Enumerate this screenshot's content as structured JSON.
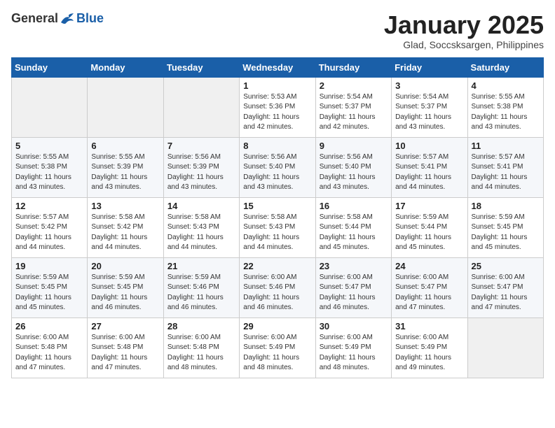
{
  "logo": {
    "general": "General",
    "blue": "Blue"
  },
  "title": "January 2025",
  "subtitle": "Glad, Soccsksargen, Philippines",
  "days_header": [
    "Sunday",
    "Monday",
    "Tuesday",
    "Wednesday",
    "Thursday",
    "Friday",
    "Saturday"
  ],
  "weeks": [
    [
      {
        "day": "",
        "info": ""
      },
      {
        "day": "",
        "info": ""
      },
      {
        "day": "",
        "info": ""
      },
      {
        "day": "1",
        "info": "Sunrise: 5:53 AM\nSunset: 5:36 PM\nDaylight: 11 hours and 42 minutes."
      },
      {
        "day": "2",
        "info": "Sunrise: 5:54 AM\nSunset: 5:37 PM\nDaylight: 11 hours and 42 minutes."
      },
      {
        "day": "3",
        "info": "Sunrise: 5:54 AM\nSunset: 5:37 PM\nDaylight: 11 hours and 43 minutes."
      },
      {
        "day": "4",
        "info": "Sunrise: 5:55 AM\nSunset: 5:38 PM\nDaylight: 11 hours and 43 minutes."
      }
    ],
    [
      {
        "day": "5",
        "info": "Sunrise: 5:55 AM\nSunset: 5:38 PM\nDaylight: 11 hours and 43 minutes."
      },
      {
        "day": "6",
        "info": "Sunrise: 5:55 AM\nSunset: 5:39 PM\nDaylight: 11 hours and 43 minutes."
      },
      {
        "day": "7",
        "info": "Sunrise: 5:56 AM\nSunset: 5:39 PM\nDaylight: 11 hours and 43 minutes."
      },
      {
        "day": "8",
        "info": "Sunrise: 5:56 AM\nSunset: 5:40 PM\nDaylight: 11 hours and 43 minutes."
      },
      {
        "day": "9",
        "info": "Sunrise: 5:56 AM\nSunset: 5:40 PM\nDaylight: 11 hours and 43 minutes."
      },
      {
        "day": "10",
        "info": "Sunrise: 5:57 AM\nSunset: 5:41 PM\nDaylight: 11 hours and 44 minutes."
      },
      {
        "day": "11",
        "info": "Sunrise: 5:57 AM\nSunset: 5:41 PM\nDaylight: 11 hours and 44 minutes."
      }
    ],
    [
      {
        "day": "12",
        "info": "Sunrise: 5:57 AM\nSunset: 5:42 PM\nDaylight: 11 hours and 44 minutes."
      },
      {
        "day": "13",
        "info": "Sunrise: 5:58 AM\nSunset: 5:42 PM\nDaylight: 11 hours and 44 minutes."
      },
      {
        "day": "14",
        "info": "Sunrise: 5:58 AM\nSunset: 5:43 PM\nDaylight: 11 hours and 44 minutes."
      },
      {
        "day": "15",
        "info": "Sunrise: 5:58 AM\nSunset: 5:43 PM\nDaylight: 11 hours and 44 minutes."
      },
      {
        "day": "16",
        "info": "Sunrise: 5:58 AM\nSunset: 5:44 PM\nDaylight: 11 hours and 45 minutes."
      },
      {
        "day": "17",
        "info": "Sunrise: 5:59 AM\nSunset: 5:44 PM\nDaylight: 11 hours and 45 minutes."
      },
      {
        "day": "18",
        "info": "Sunrise: 5:59 AM\nSunset: 5:45 PM\nDaylight: 11 hours and 45 minutes."
      }
    ],
    [
      {
        "day": "19",
        "info": "Sunrise: 5:59 AM\nSunset: 5:45 PM\nDaylight: 11 hours and 45 minutes."
      },
      {
        "day": "20",
        "info": "Sunrise: 5:59 AM\nSunset: 5:45 PM\nDaylight: 11 hours and 46 minutes."
      },
      {
        "day": "21",
        "info": "Sunrise: 5:59 AM\nSunset: 5:46 PM\nDaylight: 11 hours and 46 minutes."
      },
      {
        "day": "22",
        "info": "Sunrise: 6:00 AM\nSunset: 5:46 PM\nDaylight: 11 hours and 46 minutes."
      },
      {
        "day": "23",
        "info": "Sunrise: 6:00 AM\nSunset: 5:47 PM\nDaylight: 11 hours and 46 minutes."
      },
      {
        "day": "24",
        "info": "Sunrise: 6:00 AM\nSunset: 5:47 PM\nDaylight: 11 hours and 47 minutes."
      },
      {
        "day": "25",
        "info": "Sunrise: 6:00 AM\nSunset: 5:47 PM\nDaylight: 11 hours and 47 minutes."
      }
    ],
    [
      {
        "day": "26",
        "info": "Sunrise: 6:00 AM\nSunset: 5:48 PM\nDaylight: 11 hours and 47 minutes."
      },
      {
        "day": "27",
        "info": "Sunrise: 6:00 AM\nSunset: 5:48 PM\nDaylight: 11 hours and 47 minutes."
      },
      {
        "day": "28",
        "info": "Sunrise: 6:00 AM\nSunset: 5:48 PM\nDaylight: 11 hours and 48 minutes."
      },
      {
        "day": "29",
        "info": "Sunrise: 6:00 AM\nSunset: 5:49 PM\nDaylight: 11 hours and 48 minutes."
      },
      {
        "day": "30",
        "info": "Sunrise: 6:00 AM\nSunset: 5:49 PM\nDaylight: 11 hours and 48 minutes."
      },
      {
        "day": "31",
        "info": "Sunrise: 6:00 AM\nSunset: 5:49 PM\nDaylight: 11 hours and 49 minutes."
      },
      {
        "day": "",
        "info": ""
      }
    ]
  ]
}
